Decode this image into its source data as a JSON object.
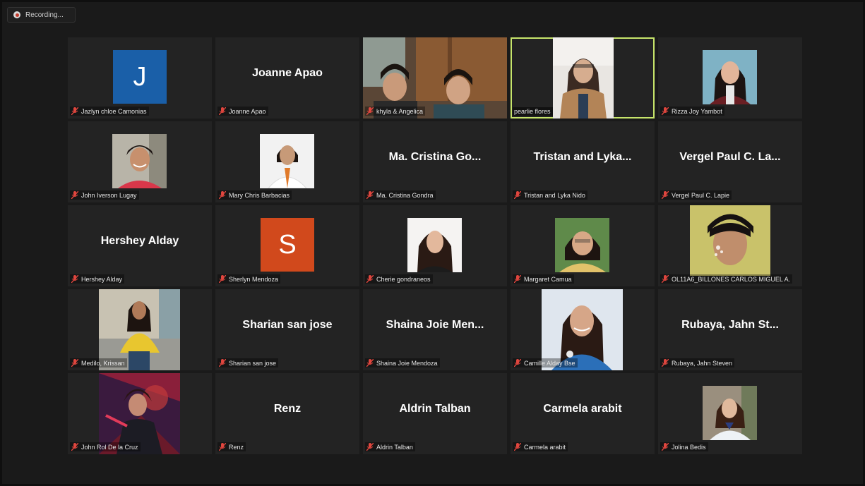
{
  "recording": {
    "label": "Recording..."
  },
  "colors": {
    "active_speaker": "#c7e56b",
    "tile_bg": "#232323",
    "avatar_blue": "#1a5fa8",
    "avatar_orange": "#d1491c",
    "mic_muted": "#e0463e"
  },
  "participants": [
    {
      "label": "Jazlyn chloe Camonias",
      "avatar_letter": "J"
    },
    {
      "label": "Joanne Apao",
      "big_name": "Joanne Apao"
    },
    {
      "label": "khyla & Angelica"
    },
    {
      "label": "pearlie flores"
    },
    {
      "label": "Rizza Joy Yambot"
    },
    {
      "label": "John Iverson Lugay"
    },
    {
      "label": "Mary Chris Barbacias"
    },
    {
      "label": "Ma. Cristina Gondra",
      "big_name": "Ma. Cristina Go..."
    },
    {
      "label": "Tristan and Lyka Nido",
      "big_name": "Tristan and Lyka..."
    },
    {
      "label": "Vergel Paul C. Lapie",
      "big_name": "Vergel Paul C. La..."
    },
    {
      "label": "Hershey Alday",
      "big_name": "Hershey Alday"
    },
    {
      "label": "Sherlyn Mendoza",
      "avatar_letter": "S"
    },
    {
      "label": "Cherie gondraneos"
    },
    {
      "label": "Margaret Camua"
    },
    {
      "label": "OL11A6_BILLONES CARLOS MIGUEL A."
    },
    {
      "label": "Medilo, Krissan"
    },
    {
      "label": "Sharian san jose",
      "big_name": "Sharian san jose"
    },
    {
      "label": "Shaina Joie Mendoza",
      "big_name": "Shaina Joie Men..."
    },
    {
      "label": "Camille Alday Bse"
    },
    {
      "label": "Rubaya, Jahn Steven",
      "big_name": "Rubaya, Jahn St..."
    },
    {
      "label": "John Rol De la Cruz"
    },
    {
      "label": "Renz",
      "big_name": "Renz"
    },
    {
      "label": "Aldrin Talban",
      "big_name": "Aldrin Talban"
    },
    {
      "label": "Carmela arabit",
      "big_name": "Carmela arabit"
    },
    {
      "label": "Jolina Bedis"
    }
  ]
}
